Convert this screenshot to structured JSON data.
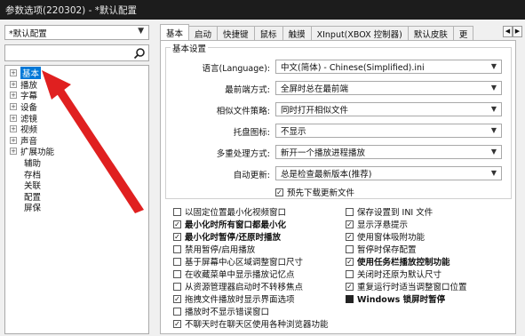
{
  "window": {
    "title": "参数选项(220302) - *默认配置"
  },
  "profile": {
    "value": "*默认配置"
  },
  "search": {
    "placeholder": ""
  },
  "tree": [
    {
      "label": "基本",
      "expander": "+",
      "selected": true
    },
    {
      "label": "播放",
      "expander": "+"
    },
    {
      "label": "字幕",
      "expander": "+"
    },
    {
      "label": "设备",
      "expander": "+"
    },
    {
      "label": "滤镜",
      "expander": "+"
    },
    {
      "label": "视频",
      "expander": "+"
    },
    {
      "label": "声音",
      "expander": "+"
    },
    {
      "label": "扩展功能",
      "expander": "+"
    },
    {
      "label": "辅助"
    },
    {
      "label": "存档"
    },
    {
      "label": "关联"
    },
    {
      "label": "配置"
    },
    {
      "label": "屏保"
    }
  ],
  "tabs": [
    "基本",
    "启动",
    "快捷键",
    "鼠标",
    "触摸",
    "XInput(XBOX 控制器)",
    "默认皮肤",
    "更"
  ],
  "group_title": "基本设置",
  "settings": [
    {
      "label": "语言(Language):",
      "value": "中文(简体) - Chinese(Simplified).ini"
    },
    {
      "label": "最前端方式:",
      "value": "全屏时总在最前端"
    },
    {
      "label": "相似文件策略:",
      "value": "同时打开相似文件"
    },
    {
      "label": "托盘图标:",
      "value": "不显示"
    },
    {
      "label": "多重处理方式:",
      "value": "新开一个播放进程播放"
    },
    {
      "label": "自动更新:",
      "value": "总是检查最新版本(推荐)"
    }
  ],
  "predownload": {
    "label": "预先下载更新文件",
    "checked": true
  },
  "left_checks": [
    {
      "label": "以固定位置最小化视频窗口",
      "checked": false
    },
    {
      "label": "最小化时所有窗口都最小化",
      "checked": true,
      "bold": true
    },
    {
      "label": "最小化时暂停/还原时播放",
      "checked": true,
      "bold": true
    },
    {
      "label": "禁用暂停/启用播放",
      "checked": false
    },
    {
      "label": "基于屏幕中心区域调整窗口尺寸",
      "checked": false
    },
    {
      "label": "在收藏菜单中显示播放记忆点",
      "checked": false
    },
    {
      "label": "从资源管理器启动时不转移焦点",
      "checked": false
    },
    {
      "label": "拖拽文件播放时显示界面选项",
      "checked": true
    },
    {
      "label": "播放时不显示错误窗口",
      "checked": false
    },
    {
      "label": "不聊天时在聊天区使用各种浏览器功能",
      "checked": true
    }
  ],
  "right_checks": [
    {
      "label": "保存设置到 INI 文件",
      "checked": false
    },
    {
      "label": "显示浮悬提示",
      "checked": true
    },
    {
      "label": "使用窗体吸附功能",
      "checked": true
    },
    {
      "label": "暂停时保存配置",
      "checked": false
    },
    {
      "label": "使用任务栏播放控制功能",
      "checked": true,
      "bold": true
    },
    {
      "label": "关闭时还原为默认尺寸",
      "checked": false
    },
    {
      "label": "重复运行时适当调整窗口位置",
      "checked": true
    },
    {
      "label": "Windows 锁屏时暂停",
      "checked": true,
      "bold": true,
      "filled": true
    }
  ],
  "colors": {
    "titlebar": "#1c1c1c",
    "selection": "#0078d7",
    "annotation_arrow": "#e02020"
  }
}
